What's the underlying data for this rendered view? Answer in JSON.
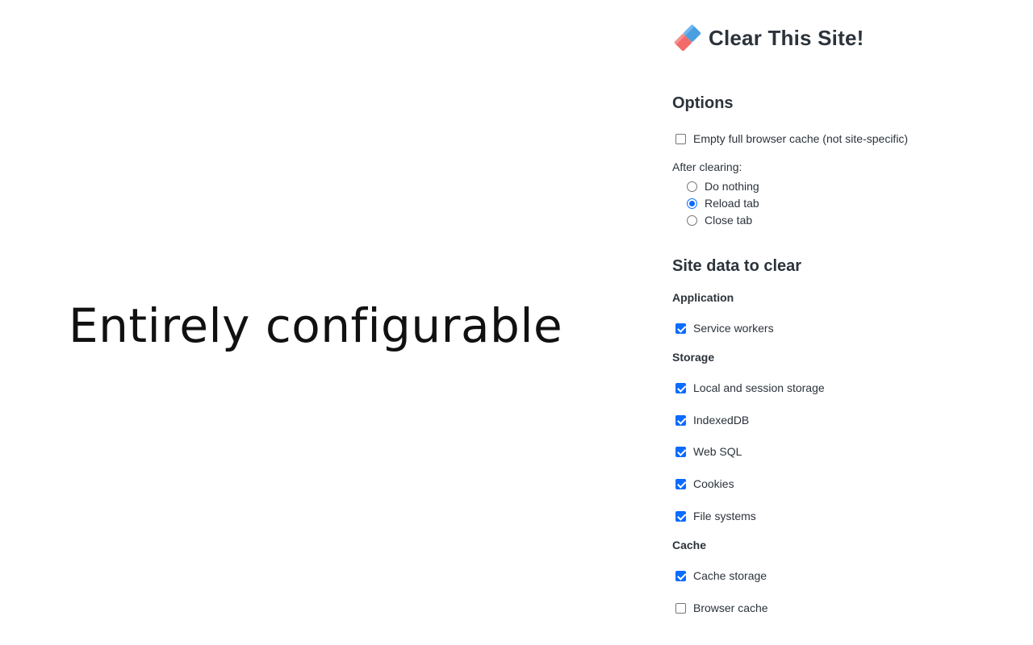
{
  "tagline": "Entirely configurable",
  "app": {
    "title": "Clear This Site!",
    "icon": "eraser-icon"
  },
  "options": {
    "heading": "Options",
    "empty_cache": {
      "label": "Empty full browser cache (not site-specific)",
      "checked": false
    },
    "after_clearing_label": "After clearing:",
    "after_clearing": [
      {
        "label": "Do nothing",
        "checked": false
      },
      {
        "label": "Reload tab",
        "checked": true
      },
      {
        "label": "Close tab",
        "checked": false
      }
    ]
  },
  "site_data": {
    "heading": "Site data to clear",
    "application": {
      "heading": "Application",
      "items": [
        {
          "label": "Service workers",
          "checked": true
        }
      ]
    },
    "storage": {
      "heading": "Storage",
      "items": [
        {
          "label": "Local and session storage",
          "checked": true
        },
        {
          "label": "IndexedDB",
          "checked": true
        },
        {
          "label": "Web SQL",
          "checked": true
        },
        {
          "label": "Cookies",
          "checked": true
        },
        {
          "label": "File systems",
          "checked": true
        }
      ]
    },
    "cache": {
      "heading": "Cache",
      "items": [
        {
          "label": "Cache storage",
          "checked": true
        },
        {
          "label": "Browser cache",
          "checked": false
        }
      ]
    }
  },
  "colors": {
    "accent": "#0b6cff",
    "text": "#2c333b",
    "eraser_red": "#f26b6b",
    "eraser_blue": "#4a9fe0"
  }
}
